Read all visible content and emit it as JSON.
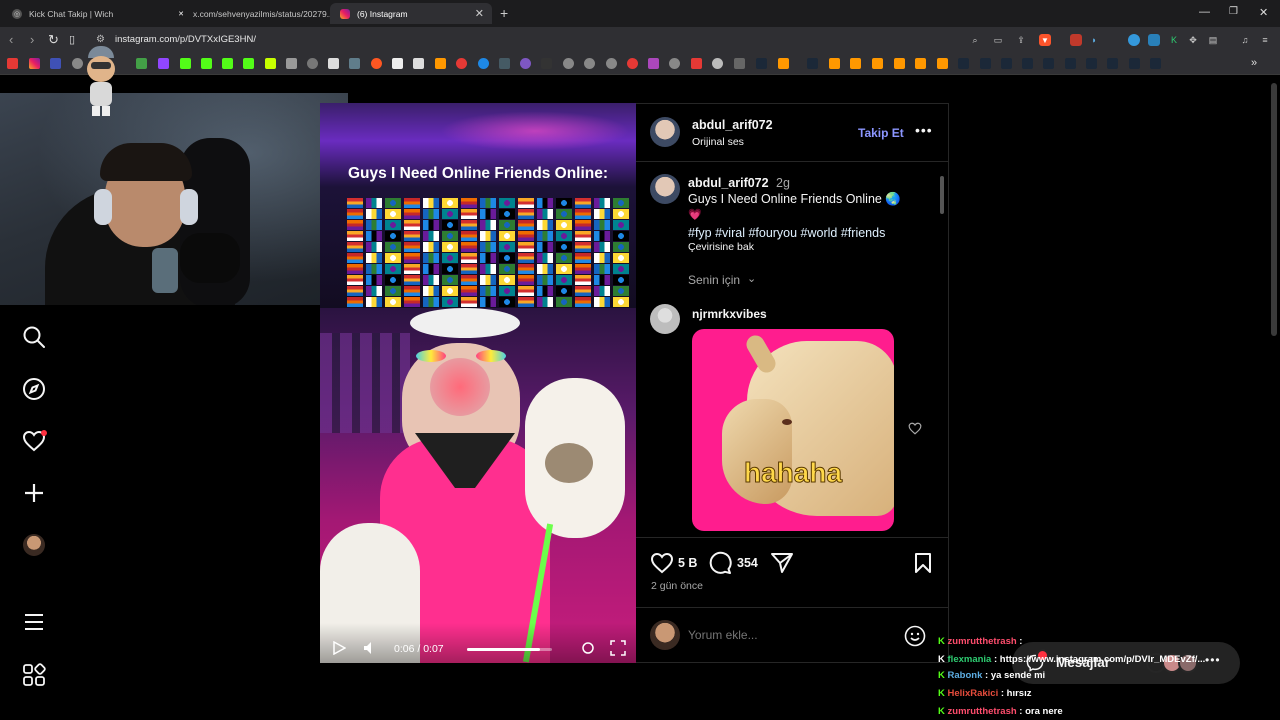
{
  "browser": {
    "tabs": [
      {
        "title": "Kick Chat Takip | Wich",
        "icon": "globe-icon"
      },
      {
        "title": "x.com/sehvenyazilmis/status/20279...",
        "icon": "x-logo-icon"
      },
      {
        "title": "(6) Instagram",
        "icon": "instagram-icon"
      }
    ],
    "url": "instagram.com/p/DVTXxIGE3HN/"
  },
  "post": {
    "author": "abdul_arif072",
    "audio": "Orijinal ses",
    "follow_label": "Takip Et",
    "caption_author": "abdul_arif072",
    "caption_age": "2g",
    "caption_text": "Guys I Need Online Friends Online 🌏",
    "caption_emoji": "💗",
    "hashtags": "#fyp #viral #fouryou #world #friends",
    "translate_label": "Çevirisine bak",
    "for_you_label": "Senin için",
    "comment_author": "njrmrkxvibes",
    "comment_sticker_text": "hahaha",
    "likes": "5 B",
    "comments": "354",
    "time_ago": "2 gün önce",
    "comment_placeholder": "Yorum ekle..."
  },
  "video": {
    "overlay_title": "Guys I Need Online Friends Online:",
    "time": "0:06 / 0:07",
    "progress": 0.86
  },
  "messages": {
    "label": "Mesajlar"
  },
  "chat": {
    "lines": [
      {
        "user": "zumrutthetrash",
        "text": "",
        "color": "#ff4d6d"
      },
      {
        "user": "flexmania",
        "text": "https://www.instagram.com/p/DVIr_MDEvZf/...",
        "color": "#2ecc71"
      },
      {
        "user": "Rabonk",
        "text": "ya sende mi",
        "color": "#5dade2"
      },
      {
        "user": "HelixRakici",
        "text": "hırsız",
        "color": "#e74c3c"
      },
      {
        "user": "zumrutthetrash",
        "text": "ora nere",
        "color": "#ff4d6d"
      }
    ]
  },
  "colors": {
    "accent": "#8c96ff",
    "like_red": "#ff3040"
  }
}
